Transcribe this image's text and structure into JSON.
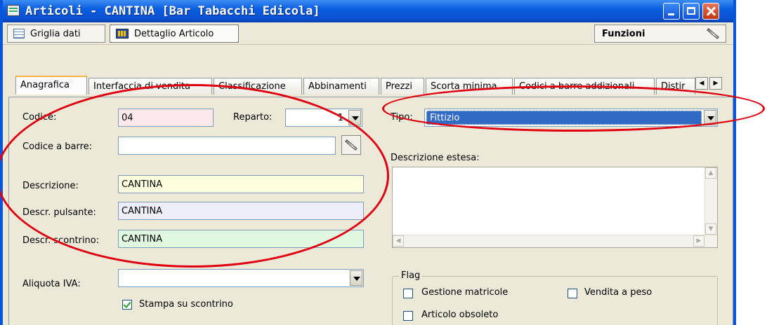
{
  "window": {
    "title": "Articoli - CANTINA   [Bar Tabacchi Edicola]"
  },
  "toolbar": {
    "grid_label": "Griglia dati",
    "detail_label": "Dettaglio Articolo",
    "functions_label": "Funzioni"
  },
  "tabs": [
    {
      "label": "Anagrafica"
    },
    {
      "label": "Interfaccia di vendita"
    },
    {
      "label": "Classificazione"
    },
    {
      "label": "Abbinamenti"
    },
    {
      "label": "Prezzi"
    },
    {
      "label": "Scorta minima"
    },
    {
      "label": "Codici a barre addizionali"
    },
    {
      "label": "Distir"
    }
  ],
  "form": {
    "codice_label": "Codice:",
    "codice_value": "04",
    "reparto_label": "Reparto:",
    "reparto_value": "1",
    "barcode_label": "Codice a barre:",
    "barcode_value": "",
    "descrizione_label": "Descrizione:",
    "descrizione_value": "CANTINA",
    "pulsante_label": "Descr. pulsante:",
    "pulsante_value": "CANTINA",
    "scontrino_label": "Descr. scontrino:",
    "scontrino_value": "CANTINA",
    "iva_label": "Aliquota IVA:",
    "iva_value": "",
    "stampa_label": "Stampa su scontrino",
    "stampa_checked": true,
    "tipo_label": "Tipo:",
    "tipo_value": "Fittizio",
    "estesa_label": "Descrizione estesa:",
    "estesa_value": ""
  },
  "flags": {
    "title": "Flag",
    "matricole_label": "Gestione matricole",
    "obsoleto_label": "Articolo obsoleto",
    "peso_label": "Vendita a peso"
  },
  "colors": {
    "codice_bg": "#fde8ec",
    "descrizione_bg": "#ffffe0",
    "pulsante_bg": "#eeeefa",
    "scontrino_bg": "#e0f8e0",
    "tipo_bg": "#316ac5",
    "annotation": "#e0000f"
  }
}
